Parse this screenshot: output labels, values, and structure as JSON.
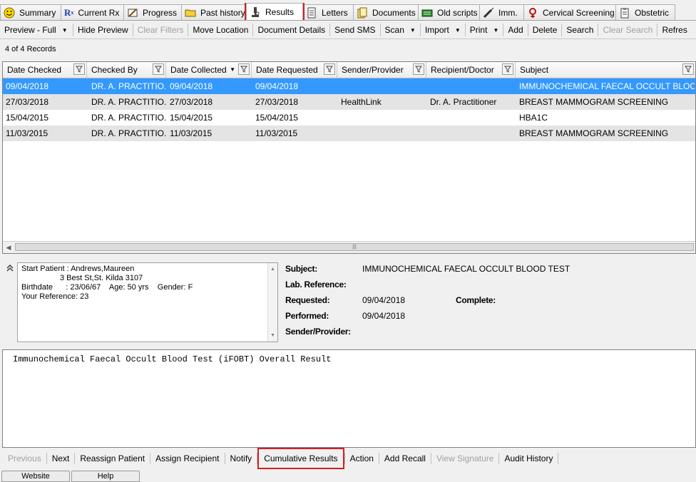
{
  "tabs": [
    {
      "label": "Summary",
      "icon": "smiley-icon",
      "name": "tab-summary"
    },
    {
      "label": "Current Rx",
      "icon": "rx-icon",
      "name": "tab-current-rx"
    },
    {
      "label": "Progress",
      "icon": "pencil-notes-icon",
      "name": "tab-progress"
    },
    {
      "label": "Past history",
      "icon": "folder-icon",
      "name": "tab-past-history"
    },
    {
      "label": "Results",
      "icon": "microscope-icon",
      "name": "tab-results",
      "active": true
    },
    {
      "label": "Letters",
      "icon": "letter-icon",
      "name": "tab-letters"
    },
    {
      "label": "Documents",
      "icon": "documents-icon",
      "name": "tab-documents"
    },
    {
      "label": "Old scripts",
      "icon": "old-scripts-icon",
      "name": "tab-old-scripts"
    },
    {
      "label": "Imm.",
      "icon": "syringe-icon",
      "name": "tab-immunisation"
    },
    {
      "label": "Cervical Screening",
      "icon": "female-symbol-icon",
      "name": "tab-cervical-screening"
    },
    {
      "label": "Obstetric",
      "icon": "clipboard-icon",
      "name": "tab-obstetric"
    }
  ],
  "toolbar": {
    "preview": "Preview - Full",
    "hide_preview": "Hide Preview",
    "clear_filters": "Clear Filters",
    "move_location": "Move Location",
    "document_details": "Document Details",
    "send_sms": "Send SMS",
    "scan": "Scan",
    "import": "Import",
    "print": "Print",
    "add": "Add",
    "delete": "Delete",
    "search": "Search",
    "clear_search": "Clear Search",
    "refresh": "Refres"
  },
  "record_count": "4 of 4 Records",
  "grid": {
    "columns": [
      "Date Checked",
      "Checked By",
      "Date Collected",
      "Date Requested",
      "Sender/Provider",
      "Recipient/Doctor",
      "Subject"
    ],
    "rows": [
      [
        "09/04/2018",
        "DR. A. PRACTITIO...",
        "09/04/2018",
        "09/04/2018",
        "",
        "",
        "IMMUNOCHEMICAL FAECAL OCCULT BLOOD ..."
      ],
      [
        "27/03/2018",
        "DR. A. PRACTITIO...",
        "27/03/2018",
        "27/03/2018",
        "HealthLink",
        "Dr. A. Practitioner",
        "BREAST MAMMOGRAM SCREENING"
      ],
      [
        "15/04/2015",
        "DR. A. PRACTITIO...",
        "15/04/2015",
        "15/04/2015",
        "",
        "",
        "HBA1C"
      ],
      [
        "11/03/2015",
        "DR. A. PRACTITIO...",
        "11/03/2015",
        "11/03/2015",
        "",
        "",
        "BREAST MAMMOGRAM SCREENING"
      ]
    ],
    "selected_row": 0
  },
  "patient": {
    "line1": "Start Patient : Andrews,Maureen",
    "line2": "3 Best St,St. Kilda 3107",
    "line3": "Birthdate      : 23/06/67    Age: 50 yrs    Gender: F",
    "line4": "Your Reference: 23"
  },
  "details": {
    "subject_label": "Subject:",
    "subject_value": "IMMUNOCHEMICAL FAECAL OCCULT BLOOD TEST",
    "labref_label": "Lab. Reference:",
    "requested_label": "Requested:",
    "requested_value": "09/04/2018",
    "complete_label": "Complete:",
    "performed_label": "Performed:",
    "performed_value": "09/04/2018",
    "sender_label": "Sender/Provider:"
  },
  "report_text": "Immunochemical Faecal Occult Blood Test (iFOBT) Overall Result",
  "bottom": {
    "previous": "Previous",
    "next": "Next",
    "reassign_patient": "Reassign Patient",
    "assign_recipient": "Assign Recipient",
    "notify": "Notify",
    "cumulative_results": "Cumulative Results",
    "action": "Action",
    "add_recall": "Add Recall",
    "view_signature": "View Signature",
    "audit_history": "Audit History"
  },
  "footer_tabs": [
    "Website",
    "Help"
  ],
  "colors": {
    "selection": "#3399ff",
    "highlight_box": "#d42020",
    "alt_row": "#e4e4e4"
  }
}
